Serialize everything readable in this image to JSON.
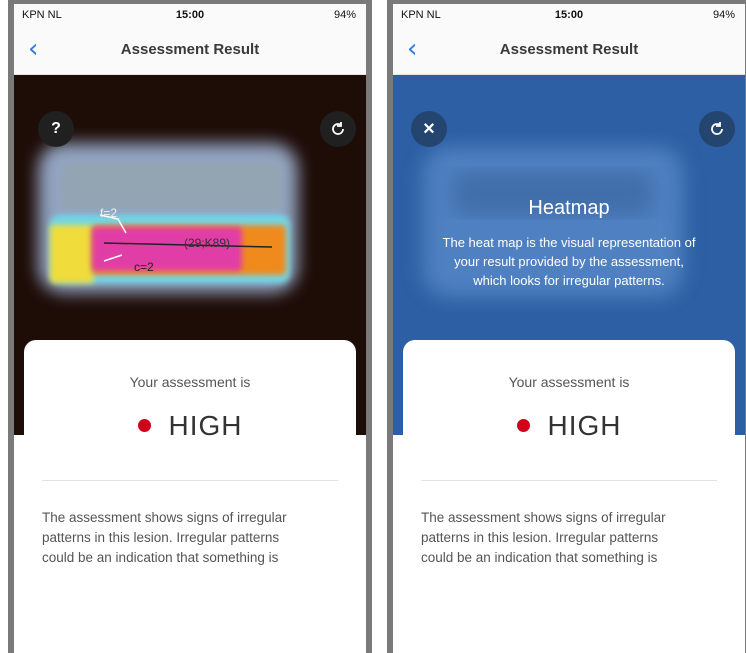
{
  "status_bar": {
    "carrier": "KPN NL",
    "time": "15:00",
    "battery": "94%"
  },
  "navbar": {
    "back_label": "‹",
    "title": "Assessment Result"
  },
  "heatmap_panel": {
    "help_label": "?",
    "refresh_icon": "refresh-icon",
    "annotation_f": "f=2",
    "annotation_c": "c=2",
    "annotation_coord": "(29;K89)"
  },
  "info_overlay": {
    "close_label": "×",
    "title": "Heatmap",
    "text_lines": [
      "The heat map is the visual representation of",
      "your result provided by the assessment,",
      "which looks for irregular patterns."
    ]
  },
  "result": {
    "label": "Your assessment is",
    "level": "HIGH",
    "level_color": "#d0021b",
    "description_lines": [
      "The assessment shows signs of irregular",
      "patterns in this lesion. Irregular patterns",
      "could be an indication that something is"
    ]
  }
}
